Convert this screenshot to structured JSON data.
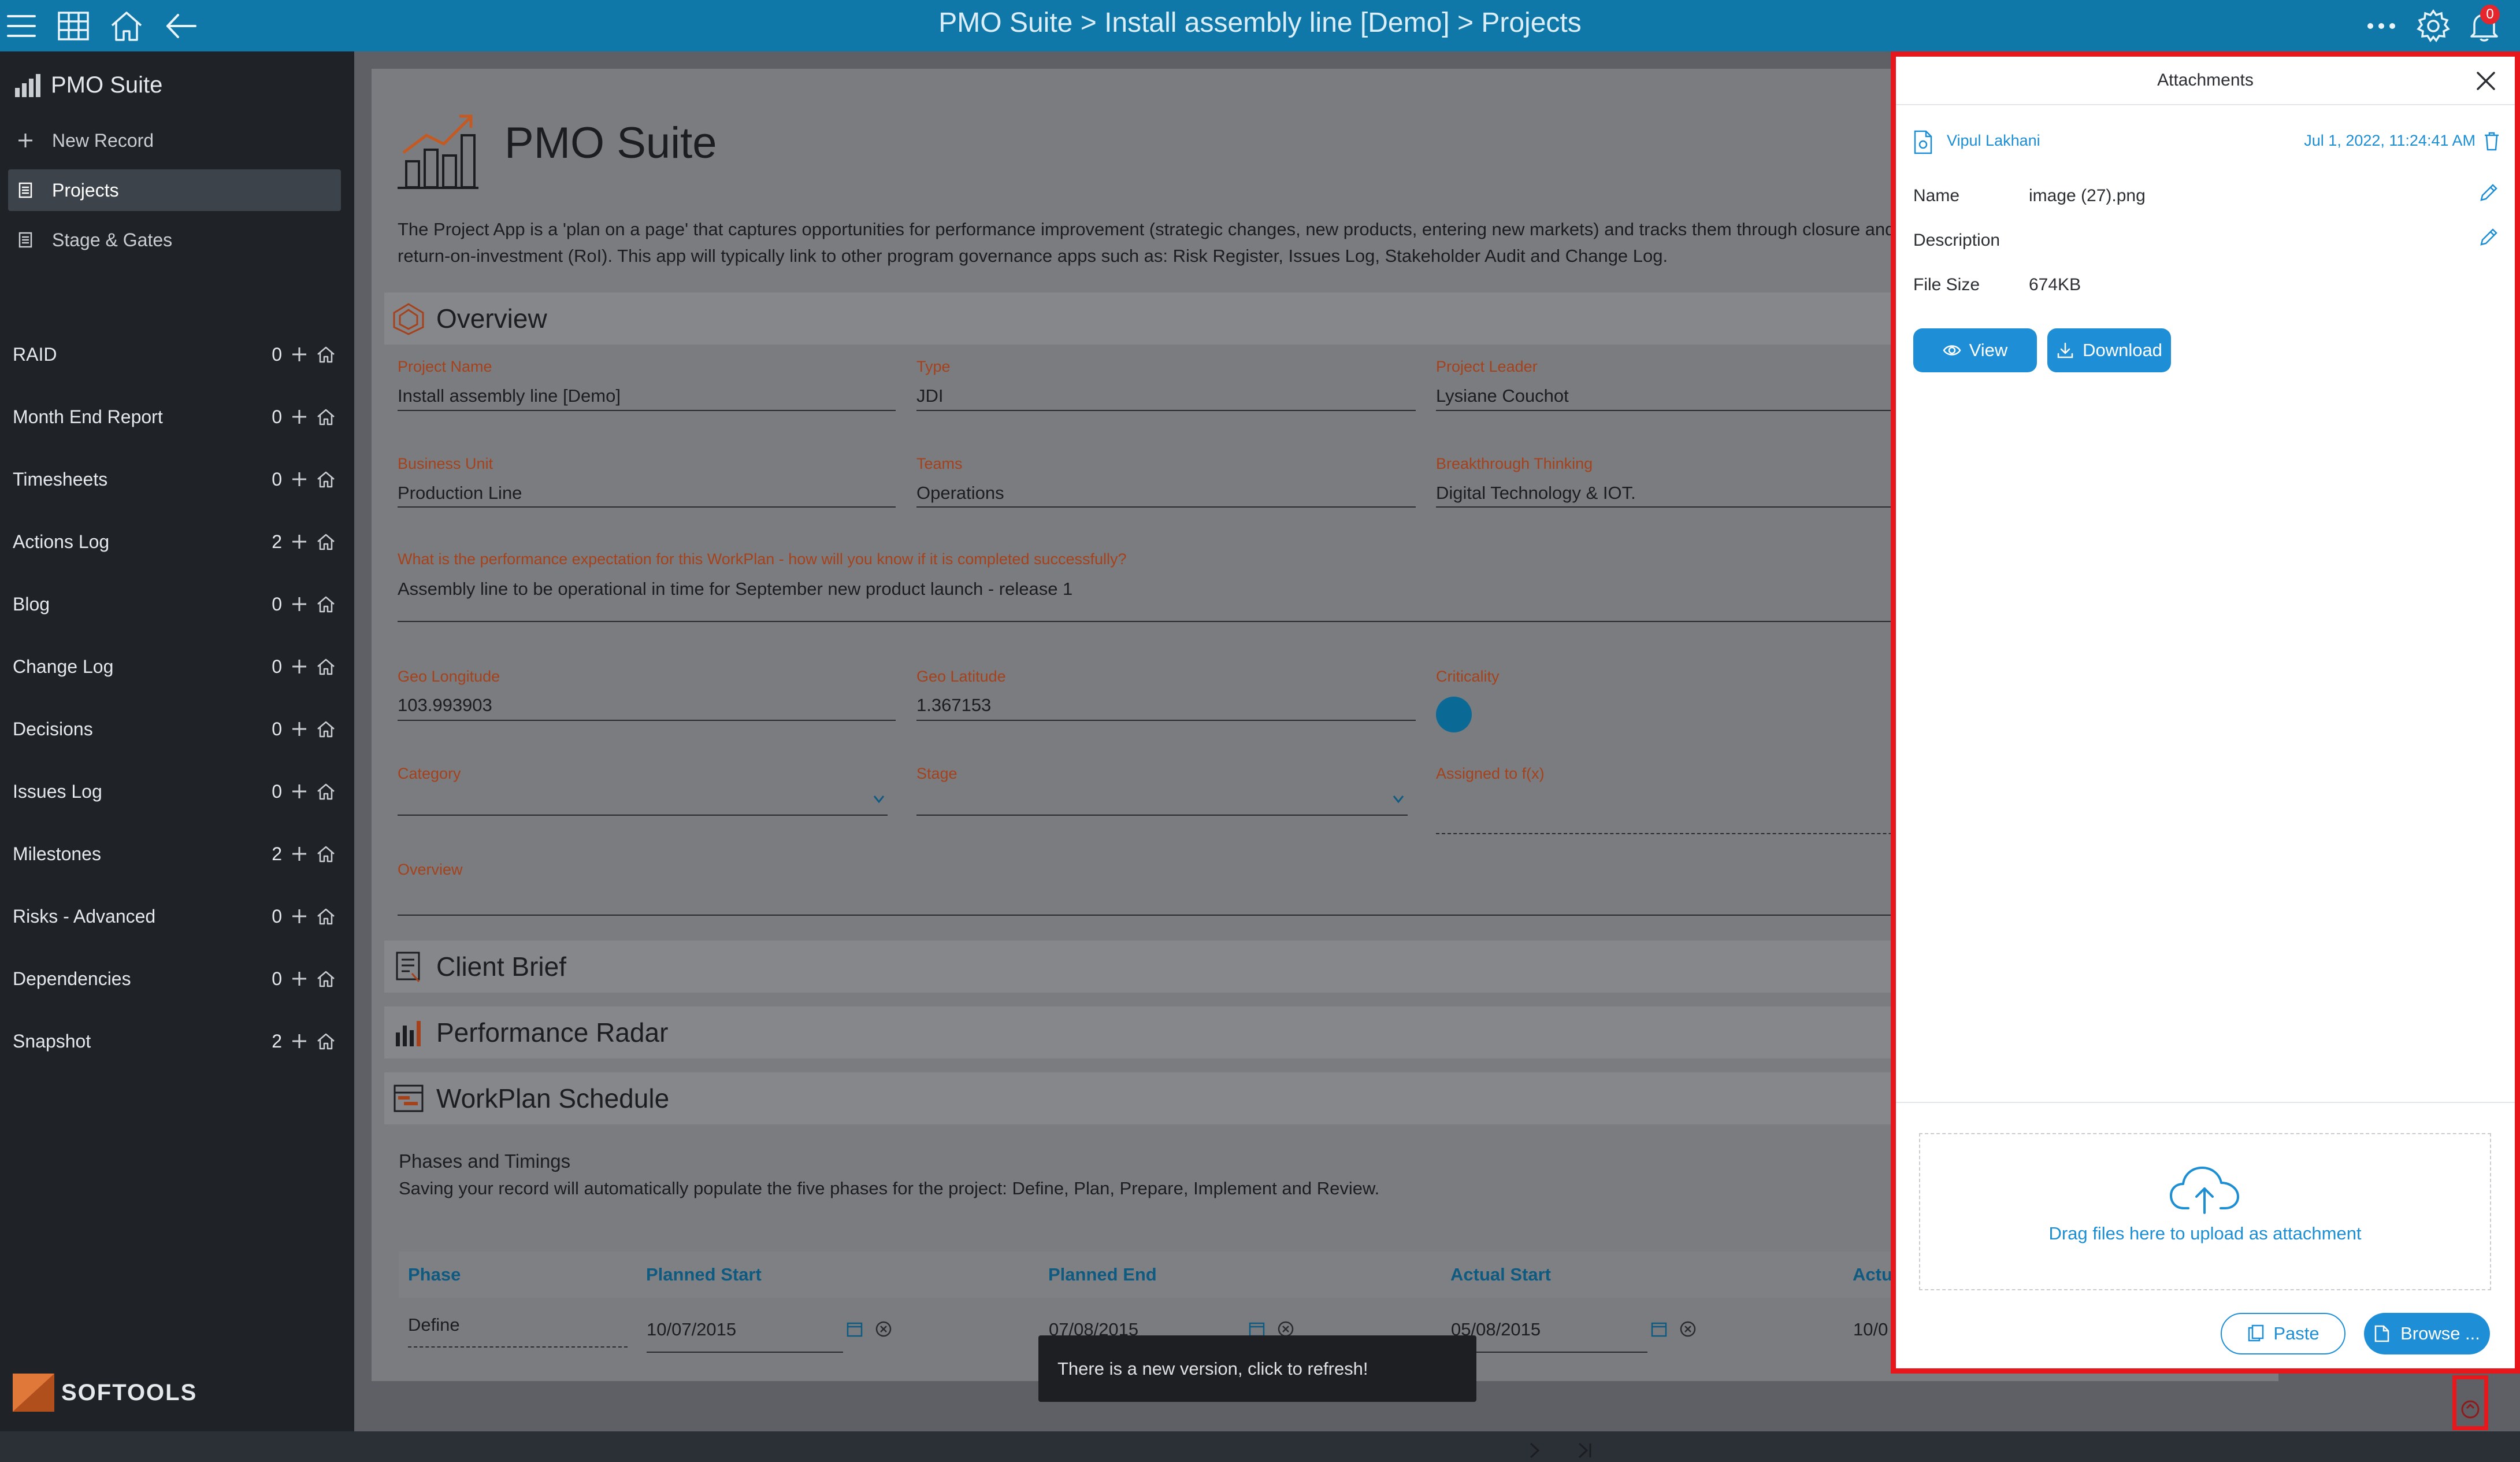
{
  "topbar": {
    "title": "PMO Suite > Install assembly line [Demo] > Projects",
    "notification_count": "0",
    "icons": [
      "menu-icon",
      "grid-icon",
      "home-icon",
      "back-arrow-icon",
      "more-icon",
      "gear-icon",
      "bell-icon"
    ]
  },
  "sidebar": {
    "app_name": "PMO Suite",
    "top_items": [
      {
        "label": "New Record",
        "icon": "plus-icon"
      },
      {
        "label": "Projects",
        "icon": "document-icon",
        "active": true
      },
      {
        "label": "Stage & Gates",
        "icon": "document-icon"
      }
    ],
    "items": [
      {
        "label": "RAID",
        "count": "0"
      },
      {
        "label": "Month End Report",
        "count": "0"
      },
      {
        "label": "Timesheets",
        "count": "0"
      },
      {
        "label": "Actions Log",
        "count": "2"
      },
      {
        "label": "Blog",
        "count": "0"
      },
      {
        "label": "Change Log",
        "count": "0"
      },
      {
        "label": "Decisions",
        "count": "0"
      },
      {
        "label": "Issues Log",
        "count": "0"
      },
      {
        "label": "Milestones",
        "count": "2"
      },
      {
        "label": "Risks - Advanced",
        "count": "0"
      },
      {
        "label": "Dependencies",
        "count": "0"
      },
      {
        "label": "Snapshot",
        "count": "2"
      }
    ],
    "logo_text": "SOFTOOLS"
  },
  "main": {
    "app_title": "PMO Suite",
    "description": "The Project App is a 'plan on a page' that captures opportunities for performance improvement (strategic changes, new products, entering new markets) and tracks them through closure and return-on-investment (RoI). This app will typically link to other program governance apps such as: Risk Register, Issues Log, Stakeholder Audit and Change Log.",
    "sections": {
      "overview": "Overview",
      "client_brief": "Client Brief",
      "performance_radar": "Performance Radar",
      "workplan": "WorkPlan Schedule"
    },
    "fields": {
      "project_name": {
        "label": "Project Name",
        "value": "Install assembly line [Demo]"
      },
      "type": {
        "label": "Type",
        "value": "JDI"
      },
      "project_leader": {
        "label": "Project Leader",
        "value": "Lysiane Couchot"
      },
      "business_unit": {
        "label": "Business Unit",
        "value": "Production Line"
      },
      "teams": {
        "label": "Teams",
        "value": "Operations"
      },
      "breakthrough": {
        "label": "Breakthrough Thinking",
        "value": "Digital Technology & IOT."
      },
      "performance": {
        "label": "What is the performance expectation for this WorkPlan - how will you know if it is completed successfully?",
        "value": "Assembly line to be operational in time for September new product launch - release 1"
      },
      "geo_longitude": {
        "label": "Geo Longitude",
        "value": "103.993903"
      },
      "geo_latitude": {
        "label": "Geo Latitude",
        "value": "1.367153"
      },
      "criticality": {
        "label": "Criticality",
        "color": "#0b6a95"
      },
      "category": {
        "label": "Category"
      },
      "stage": {
        "label": "Stage"
      },
      "assigned_to": {
        "label": "Assigned to f(x)"
      },
      "overview": {
        "label": "Overview"
      }
    },
    "phases": {
      "heading": "Phases and Timings",
      "text": "Saving your record will automatically populate the five phases for the project: Define, Plan, Prepare, Implement and Review.",
      "columns": [
        "Phase",
        "Planned Start",
        "Planned End",
        "Actual Start",
        "Actu"
      ],
      "row": {
        "phase": "Define",
        "planned_start": "10/07/2015",
        "planned_end": "07/08/2015",
        "actual_start": "05/08/2015",
        "actual_end": "10/0"
      }
    },
    "toast": "There is a new version, click to refresh!"
  },
  "attachments": {
    "title": "Attachments",
    "user": "Vipul Lakhani",
    "date": "Jul 1, 2022, 11:24:41 AM",
    "name_label": "Name",
    "name_value": "image (27).png",
    "description_label": "Description",
    "description_value": "",
    "filesize_label": "File Size",
    "filesize_value": "674KB",
    "view_label": "View",
    "download_label": "Download",
    "drop_text": "Drag files here to upload as attachment",
    "paste_label": "Paste",
    "browse_label": "Browse ...",
    "accent": "#1e8fd6"
  }
}
